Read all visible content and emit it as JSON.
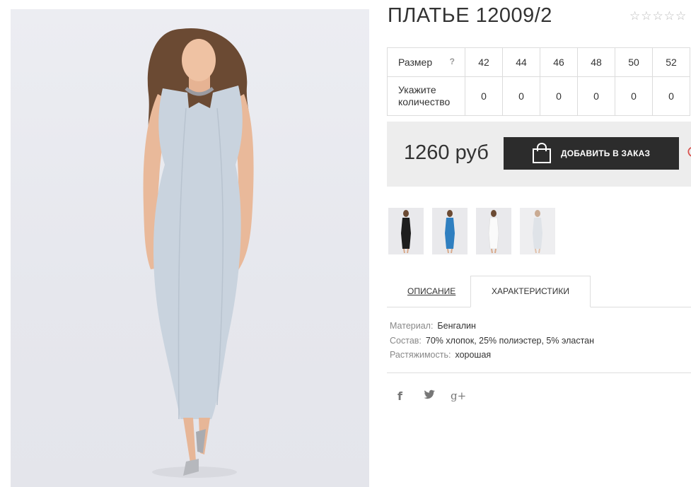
{
  "product": {
    "title": "ПЛАТЬЕ 12009/2",
    "rating_stars": "☆☆☆☆☆",
    "main_image": "dress-photo"
  },
  "size_table": {
    "size_label": "Размер",
    "help": "?",
    "sizes": [
      "42",
      "44",
      "46",
      "48",
      "50",
      "52"
    ],
    "qty_label_line1": "Укажите",
    "qty_label_line2": "количество",
    "quantities": [
      "0",
      "0",
      "0",
      "0",
      "0",
      "0"
    ]
  },
  "purchase": {
    "price": "1260 руб",
    "order_button": "ДОБАВИТЬ В ЗАКАЗ"
  },
  "thumbnails": [
    {
      "color": "black"
    },
    {
      "color": "blue"
    },
    {
      "color": "white"
    },
    {
      "color": "light-grey"
    }
  ],
  "tabs": {
    "description": "ОПИСАНИЕ",
    "characteristics": "ХАРАКТЕРИСТИКИ"
  },
  "specs": [
    {
      "key": "Материал:",
      "value": "Бенгалин"
    },
    {
      "key": "Состав:",
      "value": "70% хлопок, 25% полиэстер, 5% эластан"
    },
    {
      "key": "Растяжимость:",
      "value": "хорошая"
    }
  ],
  "social": {
    "facebook": "f",
    "twitter": "twitter-icon",
    "googleplus": "g+"
  },
  "colors": {
    "button": "#2c2c2c",
    "price_bg": "#ededed",
    "heart": "#d9534f"
  }
}
